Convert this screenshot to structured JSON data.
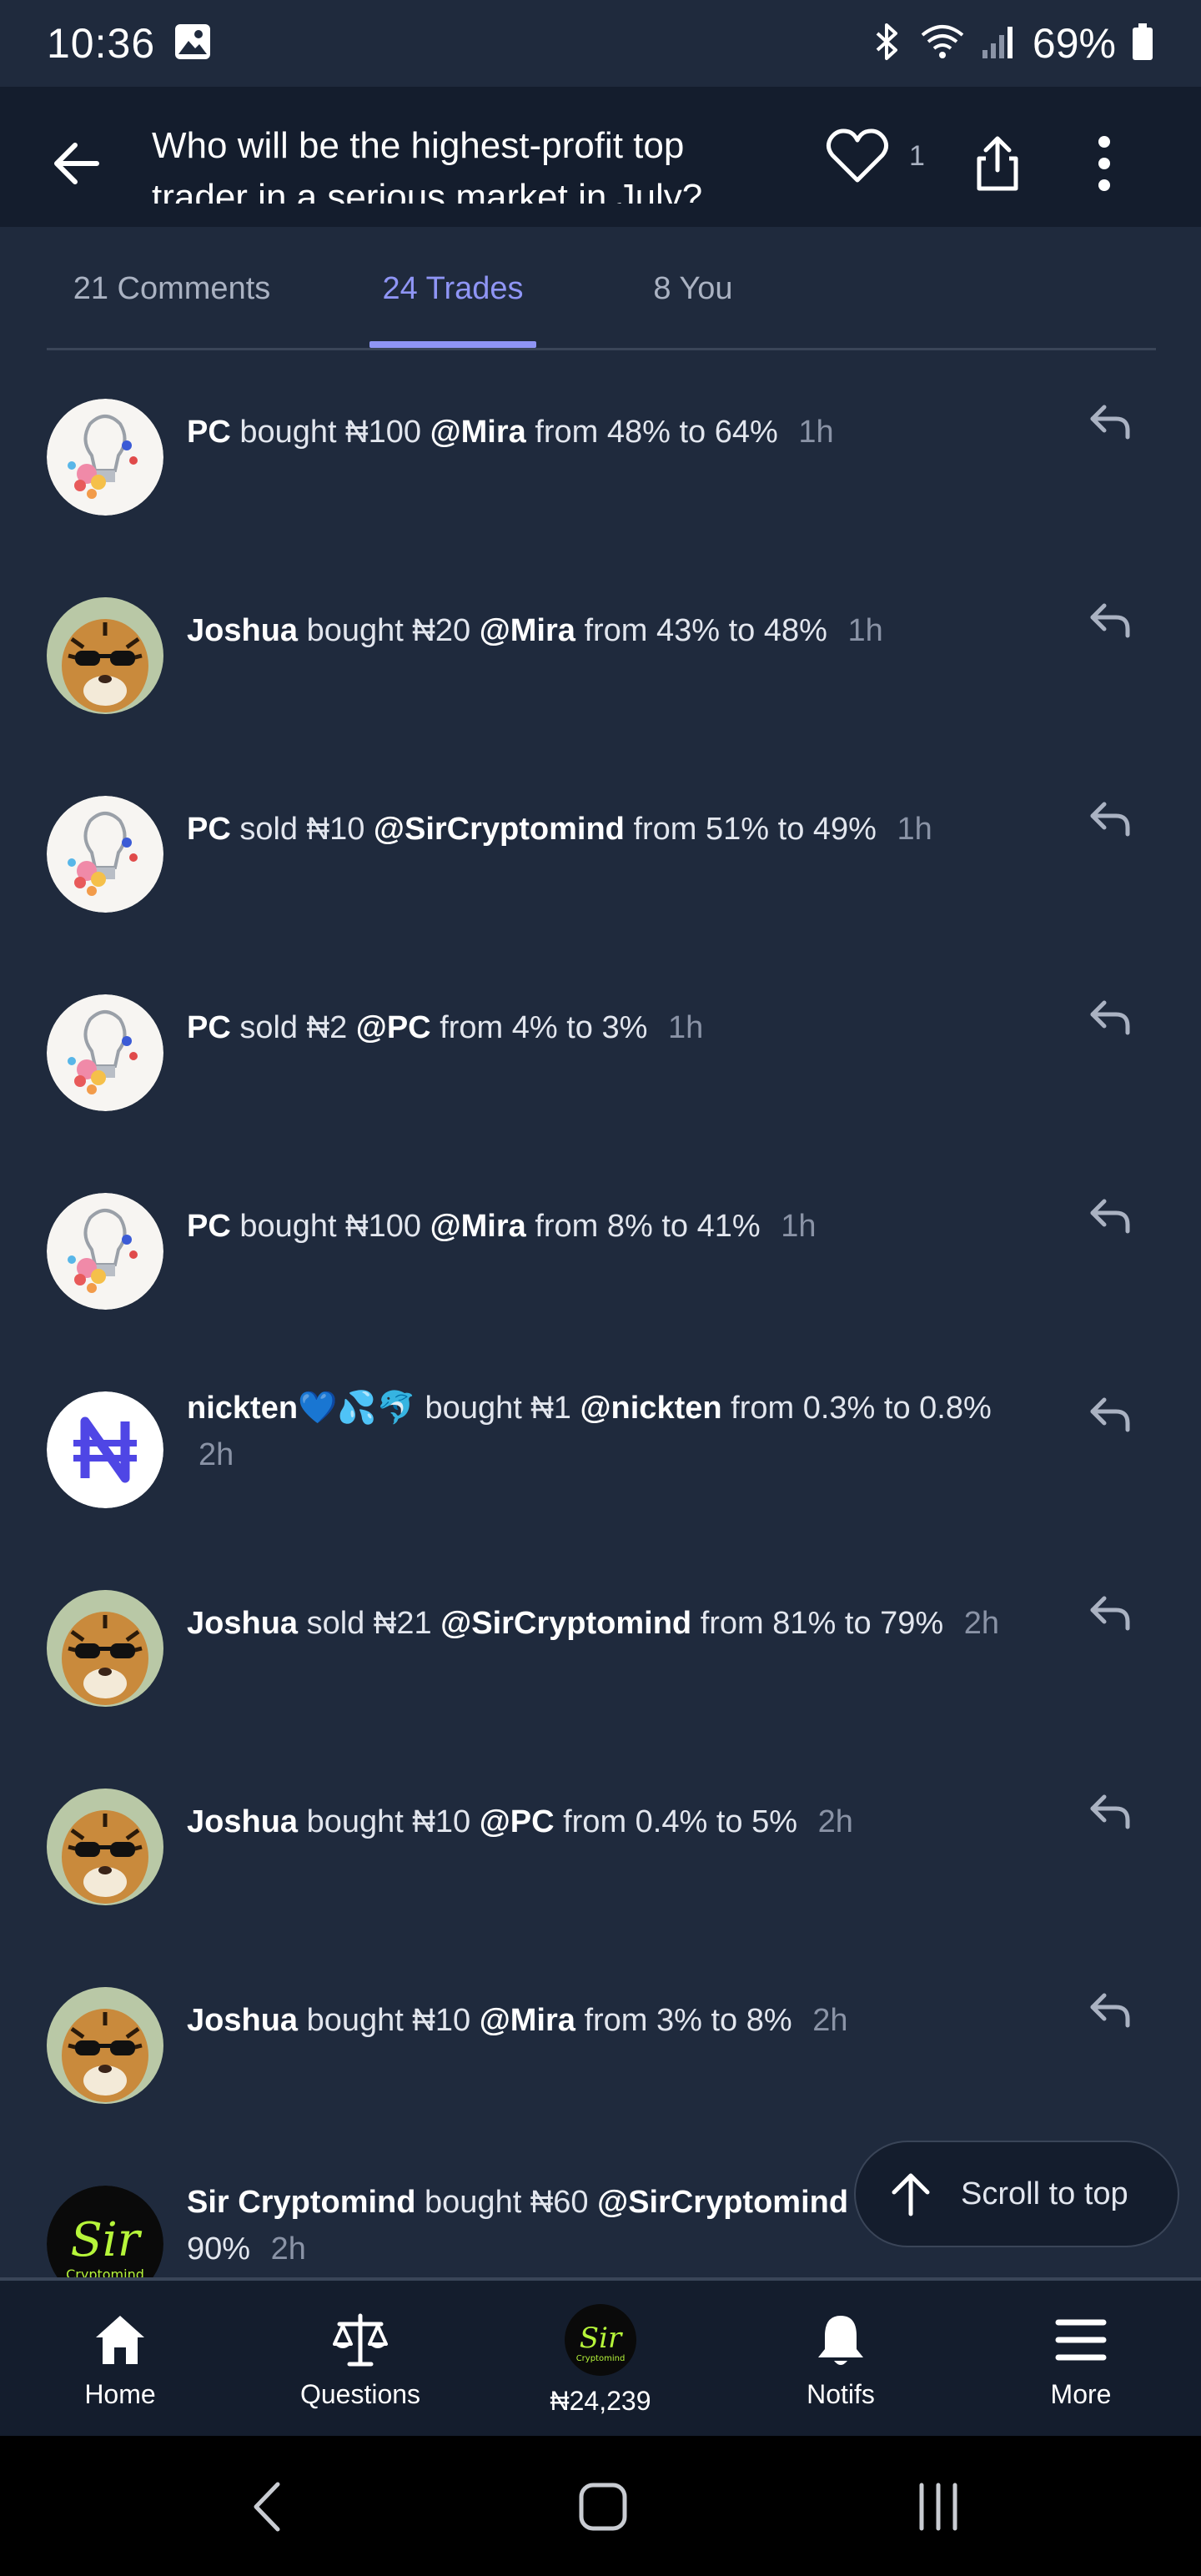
{
  "status_bar": {
    "time": "10:36",
    "battery": "69%"
  },
  "top_bar": {
    "title": "Who will be the highest-profit top trader in a serious market in July?",
    "like_count": "1"
  },
  "tabs": [
    {
      "label": "21 Comments",
      "active": false
    },
    {
      "label": "24 Trades",
      "active": true
    },
    {
      "label": "8 You",
      "active": false
    }
  ],
  "trades": [
    {
      "user": "PC",
      "action": "bought",
      "amount": "₦100",
      "answer": "@Mira",
      "from": "48%",
      "to": "64%",
      "time": "1h",
      "avatar": "bulb"
    },
    {
      "user": "Joshua",
      "action": "bought",
      "amount": "₦20",
      "answer": "@Mira",
      "from": "43%",
      "to": "48%",
      "time": "1h",
      "avatar": "tiger"
    },
    {
      "user": "PC",
      "action": "sold",
      "amount": "₦10",
      "answer": "@SirCryptomind",
      "from": "51%",
      "to": "49%",
      "time": "1h",
      "avatar": "bulb"
    },
    {
      "user": "PC",
      "action": "sold",
      "amount": "₦2",
      "answer": "@PC",
      "from": "4%",
      "to": "3%",
      "time": "1h",
      "avatar": "bulb"
    },
    {
      "user": "PC",
      "action": "bought",
      "amount": "₦100",
      "answer": "@Mira",
      "from": "8%",
      "to": "41%",
      "time": "1h",
      "avatar": "bulb"
    },
    {
      "user": "nickten💙💦🐬",
      "action": "bought",
      "amount": "₦1",
      "answer": "@nickten",
      "from": "0.3%",
      "to": "0.8%",
      "time": "2h",
      "avatar": "mana"
    },
    {
      "user": "Joshua",
      "action": "sold",
      "amount": "₦21",
      "answer": "@SirCryptomind",
      "from": "81%",
      "to": "79%",
      "time": "2h",
      "avatar": "tiger"
    },
    {
      "user": "Joshua",
      "action": "bought",
      "amount": "₦10",
      "answer": "@PC",
      "from": "0.4%",
      "to": "5%",
      "time": "2h",
      "avatar": "tiger"
    },
    {
      "user": "Joshua",
      "action": "bought",
      "amount": "₦10",
      "answer": "@Mira",
      "from": "3%",
      "to": "8%",
      "time": "2h",
      "avatar": "tiger"
    },
    {
      "user": "Sir Cryptomind",
      "action": "bought",
      "amount": "₦60",
      "answer": "@SirCryptomind",
      "from": "",
      "to": "90%",
      "time": "2h",
      "avatar": "sir"
    }
  ],
  "words": {
    "from": "from",
    "to": "to"
  },
  "scroll_top": {
    "label": "Scroll to top"
  },
  "bottom_nav": [
    {
      "label": "Home",
      "icon": "home-icon"
    },
    {
      "label": "Questions",
      "icon": "scale-icon"
    },
    {
      "label": "₦24,239",
      "icon": "avatar"
    },
    {
      "label": "Notifs",
      "icon": "bell-icon"
    },
    {
      "label": "More",
      "icon": "menu-icon"
    }
  ],
  "colors": {
    "background": "#1f2a3d",
    "top_bar": "#141d2d",
    "accent": "#8f95f5"
  }
}
